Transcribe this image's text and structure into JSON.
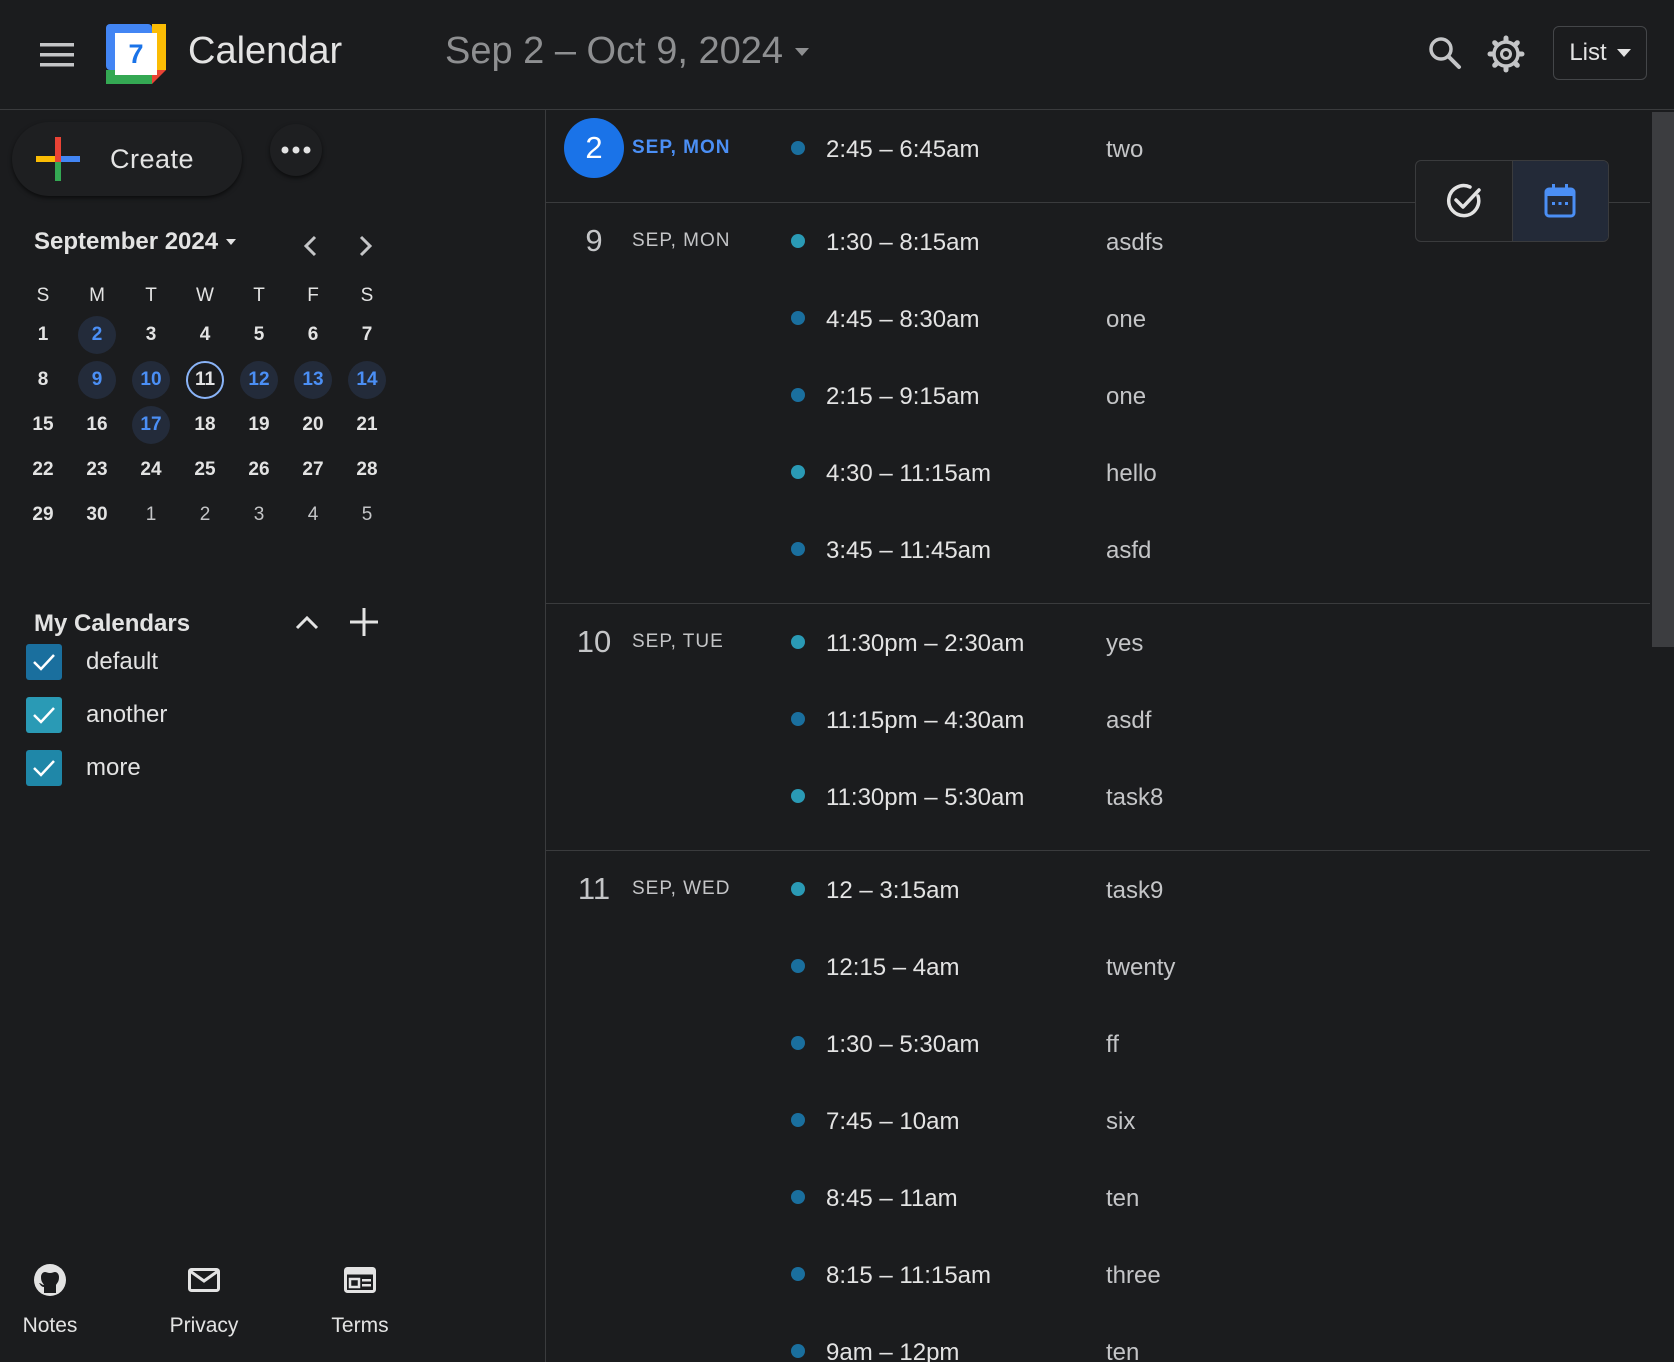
{
  "header": {
    "app_title": "Calendar",
    "logo_day": "7",
    "date_range": "Sep 2 – Oct 9, 2024",
    "view_label": "List"
  },
  "sidebar": {
    "create_label": "Create",
    "mini_cal": {
      "month_label": "September 2024",
      "dow": [
        "S",
        "M",
        "T",
        "W",
        "T",
        "F",
        "S"
      ],
      "weeks": [
        [
          {
            "d": "1"
          },
          {
            "d": "2",
            "s": "evt"
          },
          {
            "d": "3"
          },
          {
            "d": "4"
          },
          {
            "d": "5"
          },
          {
            "d": "6"
          },
          {
            "d": "7"
          }
        ],
        [
          {
            "d": "8"
          },
          {
            "d": "9",
            "s": "evt"
          },
          {
            "d": "10",
            "s": "evt"
          },
          {
            "d": "11",
            "s": "today"
          },
          {
            "d": "12",
            "s": "evt"
          },
          {
            "d": "13",
            "s": "evt"
          },
          {
            "d": "14",
            "s": "evt"
          }
        ],
        [
          {
            "d": "15"
          },
          {
            "d": "16"
          },
          {
            "d": "17",
            "s": "evt"
          },
          {
            "d": "18"
          },
          {
            "d": "19"
          },
          {
            "d": "20"
          },
          {
            "d": "21"
          }
        ],
        [
          {
            "d": "22"
          },
          {
            "d": "23"
          },
          {
            "d": "24"
          },
          {
            "d": "25"
          },
          {
            "d": "26"
          },
          {
            "d": "27"
          },
          {
            "d": "28"
          }
        ],
        [
          {
            "d": "29"
          },
          {
            "d": "30"
          },
          {
            "d": "1",
            "s": "muted"
          },
          {
            "d": "2",
            "s": "muted"
          },
          {
            "d": "3",
            "s": "muted"
          },
          {
            "d": "4",
            "s": "muted"
          },
          {
            "d": "5",
            "s": "muted"
          }
        ]
      ]
    },
    "my_calendars": {
      "title": "My Calendars",
      "items": [
        {
          "name": "default",
          "color": "#1a6f9e"
        },
        {
          "name": "another",
          "color": "#2a9ab5"
        },
        {
          "name": "more",
          "color": "#1f87a8"
        }
      ]
    },
    "footer": {
      "notes": "Notes",
      "privacy": "Privacy",
      "terms": "Terms"
    }
  },
  "colors": {
    "accent": "#1a73e8",
    "link_blue": "#4b8ff5",
    "dot_default": "#1a6f9e",
    "dot_another": "#2a9ab5"
  },
  "days": [
    {
      "num": "2",
      "label": "SEP, MON",
      "today": true,
      "events": [
        {
          "time": "2:45 – 6:45am",
          "title": "two",
          "color": "#1a6f9e"
        }
      ]
    },
    {
      "num": "9",
      "label": "SEP, MON",
      "events": [
        {
          "time": "1:30 – 8:15am",
          "title": "asdfs",
          "color": "#2a9ab5"
        },
        {
          "time": "4:45 – 8:30am",
          "title": "one",
          "color": "#1a6f9e"
        },
        {
          "time": "2:15 – 9:15am",
          "title": "one",
          "color": "#1a6f9e"
        },
        {
          "time": "4:30 – 11:15am",
          "title": "hello",
          "color": "#2a9ab5"
        },
        {
          "time": "3:45 – 11:45am",
          "title": "asfd",
          "color": "#1a6f9e"
        }
      ]
    },
    {
      "num": "10",
      "label": "SEP, TUE",
      "events": [
        {
          "time": "11:30pm – 2:30am",
          "title": "yes",
          "color": "#2a9ab5"
        },
        {
          "time": "11:15pm – 4:30am",
          "title": "asdf",
          "color": "#1a6f9e"
        },
        {
          "time": "11:30pm – 5:30am",
          "title": "task8",
          "color": "#2a9ab5"
        }
      ]
    },
    {
      "num": "11",
      "label": "SEP, WED",
      "events": [
        {
          "time": "12 – 3:15am",
          "title": "task9",
          "color": "#2a9ab5"
        },
        {
          "time": "12:15 – 4am",
          "title": "twenty",
          "color": "#1a6f9e"
        },
        {
          "time": "1:30 – 5:30am",
          "title": "ff",
          "color": "#1a6f9e"
        },
        {
          "time": "7:45 – 10am",
          "title": "six",
          "color": "#1a6f9e"
        },
        {
          "time": "8:45 – 11am",
          "title": "ten",
          "color": "#1a6f9e"
        },
        {
          "time": "8:15 – 11:15am",
          "title": "three",
          "color": "#1a6f9e"
        },
        {
          "time": "9am – 12pm",
          "title": "ten",
          "color": "#1a6f9e"
        }
      ]
    }
  ]
}
